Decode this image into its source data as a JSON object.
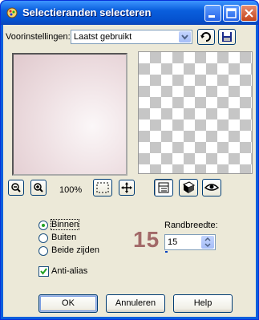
{
  "window": {
    "title": "Selectieranden selecteren",
    "title_buttons": [
      {
        "name": "minimize-icon"
      },
      {
        "name": "maximize-icon"
      },
      {
        "name": "close-icon"
      }
    ]
  },
  "presets": {
    "label": "Voorinstellingen:",
    "value": "Laatst gebruikt",
    "reset_icon": "reset-icon",
    "save_icon": "save-icon"
  },
  "zoom": {
    "level": "100%",
    "zoom_out_icon": "zoom-out-icon",
    "zoom_in_icon": "zoom-in-icon",
    "marquee_icon": "selection-marquee-icon",
    "move_icon": "move-icon"
  },
  "options": {
    "radios": [
      {
        "label": "Binnen",
        "selected": true
      },
      {
        "label": "Buiten",
        "selected": false
      },
      {
        "label": "Beide zijden",
        "selected": false
      }
    ],
    "anti_alias": {
      "label": "Anti-alias",
      "checked": true
    }
  },
  "border_width": {
    "label": "Randbreedte:",
    "big_value": "15",
    "value": "15",
    "level": 0.05
  },
  "buttons": {
    "ok": "OK",
    "cancel": "Annuleren",
    "help": "Help"
  },
  "colors": {
    "title_bar": "#0a5fdd",
    "dialog_bg": "#ece9d8",
    "big_number": "#a26968",
    "radio_dot": "#21a121"
  }
}
